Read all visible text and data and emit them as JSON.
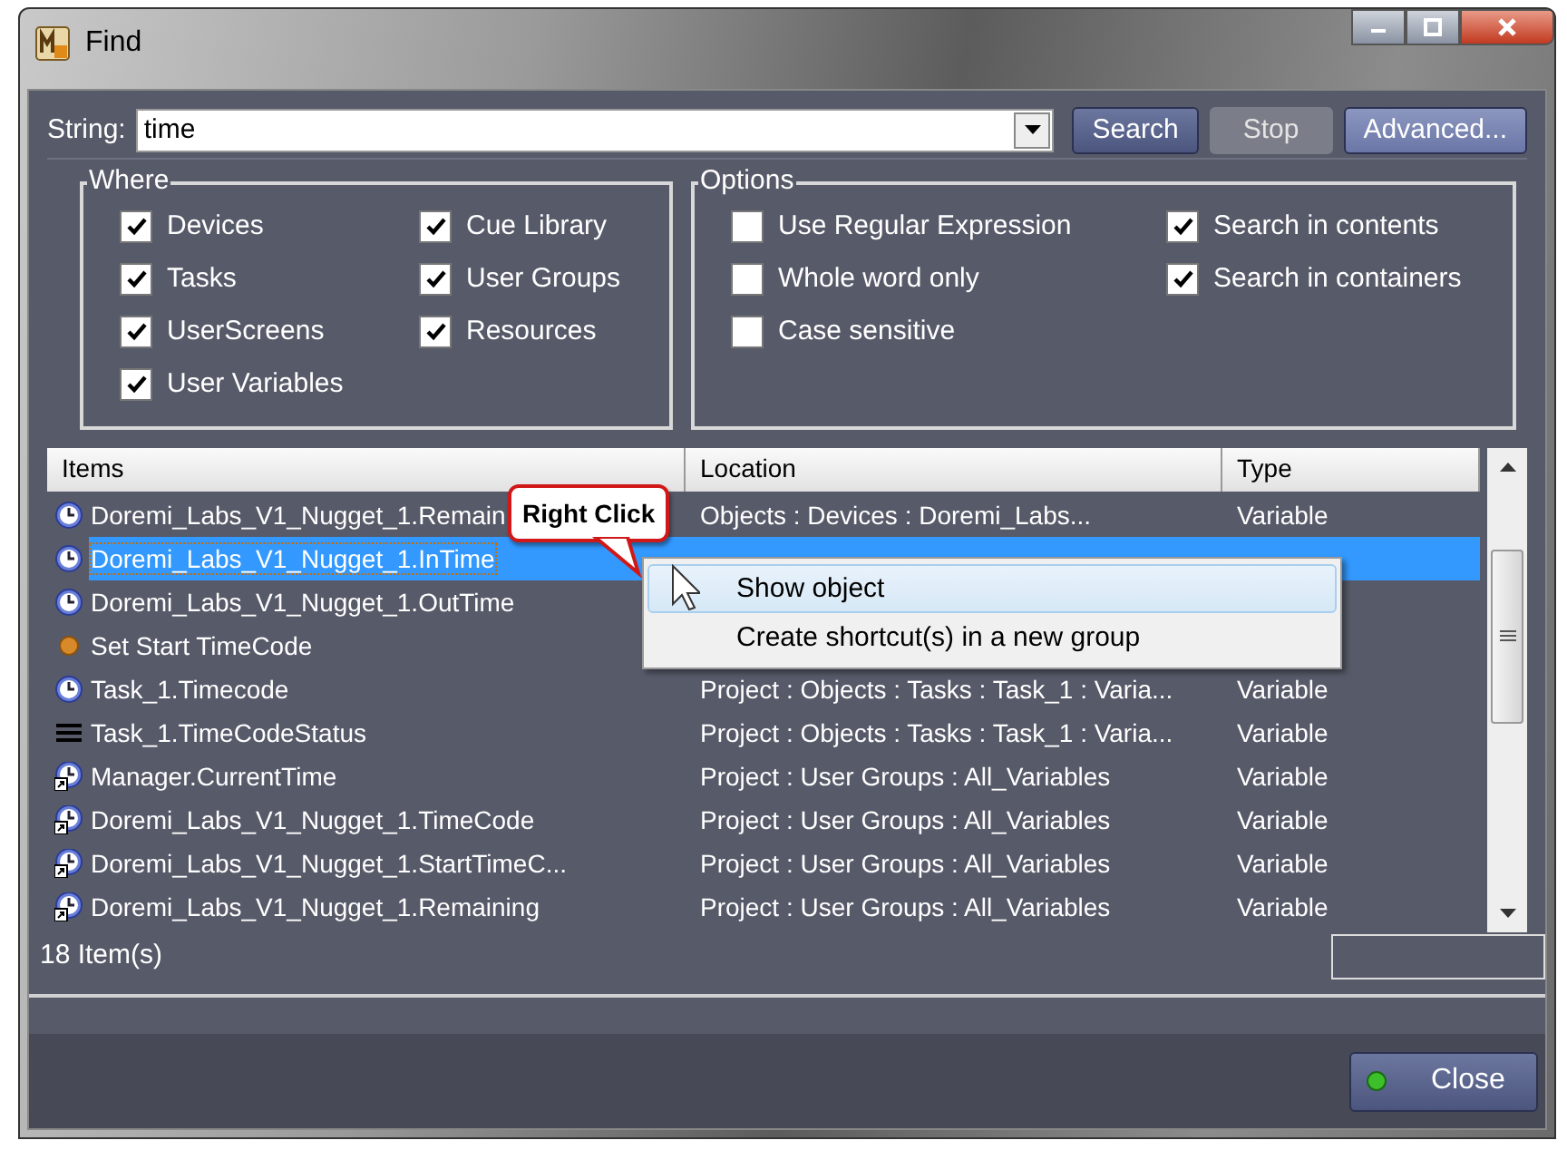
{
  "window": {
    "title": "Find"
  },
  "search": {
    "label": "String:",
    "value": "time",
    "buttons": [
      {
        "label": "Search",
        "disabled": false
      },
      {
        "label": "Stop",
        "disabled": true
      },
      {
        "label": "Advanced...",
        "disabled": false
      }
    ]
  },
  "where": {
    "title": "Where",
    "options": [
      {
        "label": "Devices",
        "checked": true
      },
      {
        "label": "Cue Library",
        "checked": true
      },
      {
        "label": "Tasks",
        "checked": true
      },
      {
        "label": "User Groups",
        "checked": true
      },
      {
        "label": "UserScreens",
        "checked": true
      },
      {
        "label": "Resources",
        "checked": true
      },
      {
        "label": "User Variables",
        "checked": true
      }
    ]
  },
  "options": {
    "title": "Options",
    "options": [
      {
        "label": "Use Regular Expression",
        "checked": false
      },
      {
        "label": "Search in contents",
        "checked": true
      },
      {
        "label": "Whole word only",
        "checked": false
      },
      {
        "label": "Search in containers",
        "checked": true
      },
      {
        "label": "Case sensitive",
        "checked": false
      }
    ]
  },
  "table": {
    "columns": [
      "Items",
      "Location",
      "Type"
    ],
    "rows": [
      {
        "kind": "clock",
        "item": "Doremi_Labs_V1_Nugget_1.Remain",
        "location": "Objects : Devices : Doremi_Labs...",
        "type": "Variable",
        "selected": false
      },
      {
        "kind": "clock",
        "item": "Doremi_Labs_V1_Nugget_1.InTime",
        "selected": true
      },
      {
        "kind": "clock",
        "item": "Doremi_Labs_V1_Nugget_1.OutTime",
        "selected": false
      },
      {
        "kind": "dot",
        "item": "Set Start TimeCode",
        "selected": false
      },
      {
        "kind": "clock",
        "item": "Task_1.Timecode",
        "location": "Project : Objects : Tasks : Task_1 : Varia...",
        "type": "Variable",
        "selected": false
      },
      {
        "kind": "lines",
        "item": "Task_1.TimeCodeStatus",
        "location": "Project : Objects : Tasks : Task_1 : Varia...",
        "type": "Variable",
        "selected": false
      },
      {
        "kind": "shortcut",
        "item": "Manager.CurrentTime",
        "location": "Project : User Groups : All_Variables",
        "type": "Variable",
        "selected": false
      },
      {
        "kind": "shortcut",
        "item": "Doremi_Labs_V1_Nugget_1.TimeCode",
        "location": "Project : User Groups : All_Variables",
        "type": "Variable",
        "selected": false
      },
      {
        "kind": "shortcut",
        "item": "Doremi_Labs_V1_Nugget_1.StartTimeC...",
        "location": "Project : User Groups : All_Variables",
        "type": "Variable",
        "selected": false
      },
      {
        "kind": "shortcut",
        "item": "Doremi_Labs_V1_Nugget_1.Remaining",
        "location": "Project : User Groups : All_Variables",
        "type": "Variable",
        "selected": false
      }
    ]
  },
  "context_menu": {
    "items": [
      {
        "label": "Show object",
        "selected": true
      },
      {
        "label": "Create shortcut(s) in a new group",
        "selected": false
      }
    ]
  },
  "callout": {
    "text": "Right Click"
  },
  "status_bar": {
    "count": "18 Item(s)"
  },
  "footer": {
    "button": "Close"
  }
}
